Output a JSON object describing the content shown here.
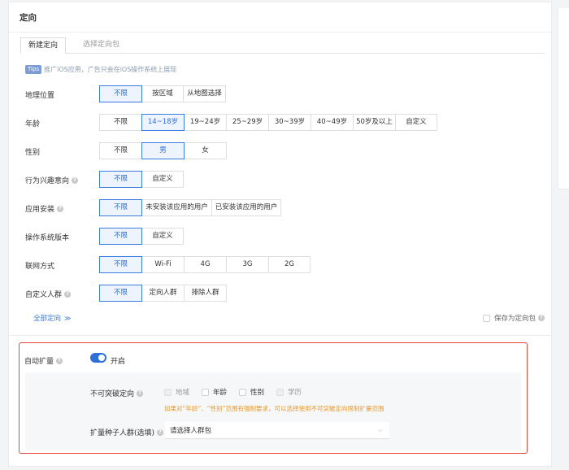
{
  "card": {
    "title": "定向"
  },
  "tabs": [
    {
      "label": "新建定向"
    },
    {
      "label": "选择定向包"
    }
  ],
  "tips": {
    "badge": "Tips",
    "text": "推广iOS应用，广告只会在iOS操作系统上展现"
  },
  "rows": [
    {
      "label": "地理位置",
      "options": [
        "不限",
        "按区域",
        "从地图选择"
      ]
    },
    {
      "label": "年龄",
      "options": [
        "不限",
        "14~18岁",
        "19~24岁",
        "25~29岁",
        "30~39岁",
        "40~49岁",
        "50岁及以上",
        "自定义"
      ]
    },
    {
      "label": "性别",
      "options": [
        "不限",
        "男",
        "女"
      ]
    },
    {
      "label": "行为兴趣意向",
      "options": [
        "不限",
        "自定义"
      ]
    },
    {
      "label": "应用安装",
      "options": [
        "不限",
        "未安装该应用的用户",
        "已安装该应用的用户"
      ]
    },
    {
      "label": "操作系统版本",
      "options": [
        "不限",
        "自定义"
      ]
    },
    {
      "label": "联网方式",
      "options": [
        "不限",
        "Wi-Fi",
        "4G",
        "3G",
        "2G"
      ]
    },
    {
      "label": "自定义人群",
      "options": [
        "不限",
        "定向人群",
        "排除人群"
      ]
    }
  ],
  "all_targeting": {
    "label": "全部定向",
    "icon": "double-chevron-down-icon"
  },
  "save_pack": {
    "label": "保存为定向包",
    "checked": false
  },
  "auto_expand": {
    "label": "自动扩量",
    "toggle_on": true,
    "toggle_label": "开启",
    "no_break": {
      "label": "不可突破定向",
      "options": [
        {
          "label": "地域",
          "checked": false,
          "disabled": true
        },
        {
          "label": "年龄",
          "checked": false,
          "disabled": false
        },
        {
          "label": "性别",
          "checked": false,
          "disabled": false
        },
        {
          "label": "学历",
          "checked": false,
          "disabled": true
        }
      ],
      "warning": "如果对“年龄”、“性别”范围有强制要求，可以选择使用不可突破定向限制扩量范围"
    },
    "seed": {
      "label": "扩量种子人群(选填)",
      "placeholder": "请选择人群包"
    }
  },
  "colors": {
    "accent": "#3a7ce0",
    "highlight_border": "#e8453c",
    "warning": "#e89a2c"
  }
}
